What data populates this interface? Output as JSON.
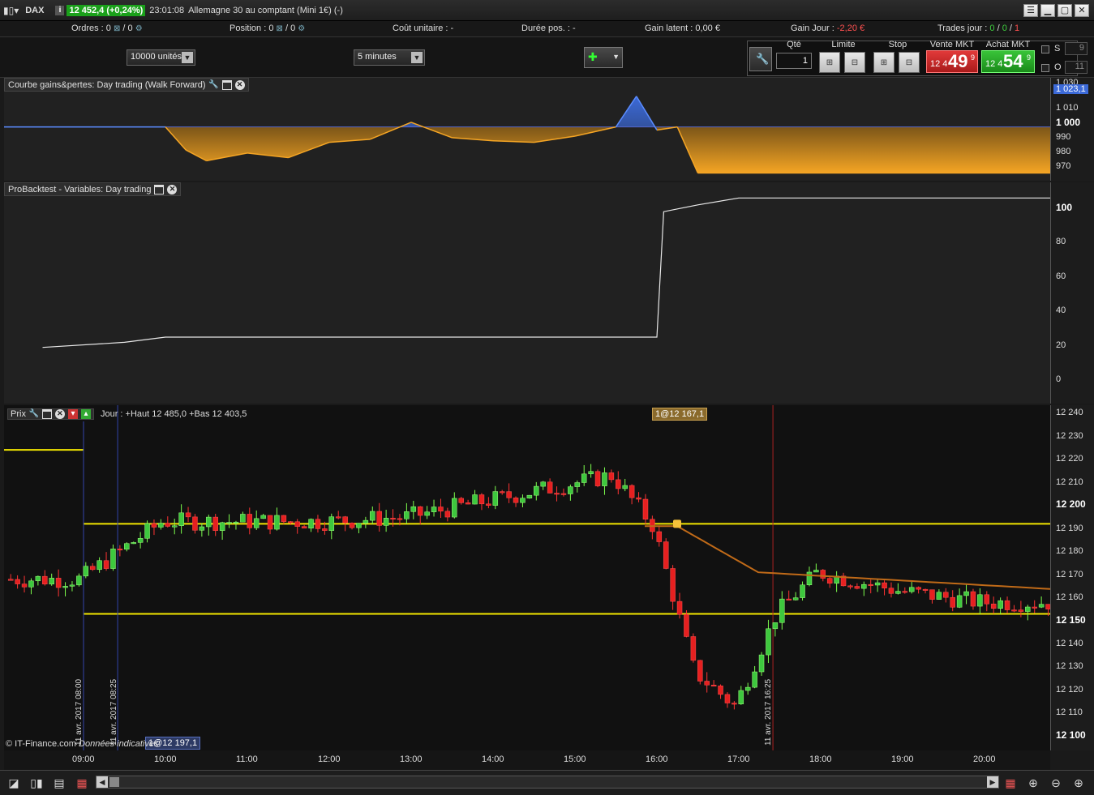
{
  "titlebar": {
    "symbol": "DAX",
    "price": "12 452,4 (+0,24%)",
    "time": "23:01:08",
    "instrument": "Allemagne 30 au comptant (Mini 1€) (-)"
  },
  "status": {
    "orders_label": "Ordres :",
    "orders_val1": "0",
    "orders_val2": "0",
    "position_label": "Position :",
    "position_val1": "0",
    "position_val2": "0",
    "unit_cost_label": "Coût unitaire :",
    "unit_cost_val": "-",
    "duration_label": "Durée pos. :",
    "duration_val": "-",
    "latent_label": "Gain latent :",
    "latent_val": "0,00 €",
    "day_gain_label": "Gain Jour :",
    "day_gain_val": "-2,20 €",
    "trades_label": "Trades jour :",
    "trades_a": "0",
    "trades_b": "0",
    "trades_c": "1"
  },
  "toolbar": {
    "units_select": "10000 unités",
    "timeframe_select": "5 minutes",
    "qty_label": "Qté",
    "qty_value": "1",
    "limit_label": "Limite",
    "stop_label": "Stop",
    "sell_label": "Vente MKT",
    "buy_label": "Achat MKT",
    "sell_prefix": "12 4",
    "sell_big": "49",
    "sell_sup": "9",
    "buy_prefix": "12 4",
    "buy_big": "54",
    "buy_sup": "9",
    "s_label": "S",
    "s_value": "9",
    "o_label": "O",
    "o_value": "11"
  },
  "equity_panel": {
    "title": "Courbe gains&pertes: Day trading (Walk Forward)",
    "axis": [
      "1 030",
      "1 023,1",
      "1 010",
      "1 000",
      "990",
      "980",
      "970"
    ]
  },
  "vars_panel": {
    "title": "ProBacktest - Variables: Day trading",
    "axis": [
      "100",
      "80",
      "60",
      "40",
      "20",
      "0"
    ]
  },
  "price_panel": {
    "title": "Prix",
    "info": "Jour : +Haut 12 485,0 +Bas 12 403,5",
    "tag_top": "1@12 167,1",
    "tag_bottom": "1@12 197,1",
    "copyright": "© IT-Finance.com",
    "disclaimer": "Données indicatives",
    "vline1": "11 avr. 2017 08:00",
    "vline2": "11 avr. 2017 08:25",
    "vline3": "11 avr. 2017 16:25",
    "axis": [
      "12 240",
      "12 230",
      "12 220",
      "12 210",
      "12 200",
      "12 190",
      "12 180",
      "12 170",
      "12 160",
      "12 150",
      "12 140",
      "12 130",
      "12 120",
      "12 110",
      "12 100"
    ]
  },
  "time_axis": [
    "09:00",
    "10:00",
    "11:00",
    "12:00",
    "13:00",
    "14:00",
    "15:00",
    "16:00",
    "17:00",
    "18:00",
    "19:00",
    "20:00"
  ],
  "chart_data": [
    {
      "type": "area",
      "title": "Courbe gains&pertes: Day trading (Walk Forward)",
      "baseline": 1000,
      "ylim": [
        965,
        1032
      ],
      "x": [
        "09:00",
        "10:00",
        "10:15",
        "10:30",
        "11:00",
        "11:30",
        "12:00",
        "12:30",
        "13:00",
        "13:30",
        "14:00",
        "14:30",
        "15:00",
        "15:30",
        "15:45",
        "16:00",
        "16:15",
        "16:30",
        "17:00",
        "18:00",
        "19:00",
        "20:00"
      ],
      "values": [
        1000,
        1000,
        985,
        978,
        983,
        980,
        990,
        992,
        1003,
        993,
        991,
        990,
        994,
        1000,
        1020,
        998,
        1000,
        970,
        970,
        970,
        970,
        970
      ]
    },
    {
      "type": "line",
      "title": "ProBacktest - Variables: Day trading",
      "ylim": [
        0,
        110
      ],
      "x": [
        "08:30",
        "09:30",
        "10:00",
        "12:00",
        "14:00",
        "16:00",
        "16:05",
        "16:30",
        "17:00",
        "20:50"
      ],
      "values": [
        19,
        22,
        25,
        25,
        25,
        25,
        98,
        102,
        106,
        106
      ]
    },
    {
      "type": "candlestick",
      "title": "Prix",
      "ylim": [
        12097,
        12243
      ],
      "levels": [
        12150,
        12189,
        12221
      ],
      "ohlc_sample": [
        [
          "09:00",
          12158,
          12168,
          12150,
          12165
        ],
        [
          "10:00",
          12185,
          12200,
          12170,
          12190
        ],
        [
          "12:00",
          12188,
          12195,
          12180,
          12190
        ],
        [
          "13:00",
          12195,
          12202,
          12188,
          12192
        ],
        [
          "15:30",
          12195,
          12222,
          12188,
          12210
        ],
        [
          "16:00",
          12190,
          12198,
          12175,
          12188
        ],
        [
          "16:30",
          12160,
          12165,
          12120,
          12125
        ],
        [
          "17:00",
          12105,
          12115,
          12097,
          12110
        ],
        [
          "17:30",
          12130,
          12165,
          12125,
          12150
        ],
        [
          "18:00",
          12150,
          12172,
          12148,
          12168
        ],
        [
          "19:00",
          12165,
          12175,
          12155,
          12160
        ],
        [
          "20:00",
          12150,
          12160,
          12145,
          12155
        ]
      ]
    }
  ]
}
